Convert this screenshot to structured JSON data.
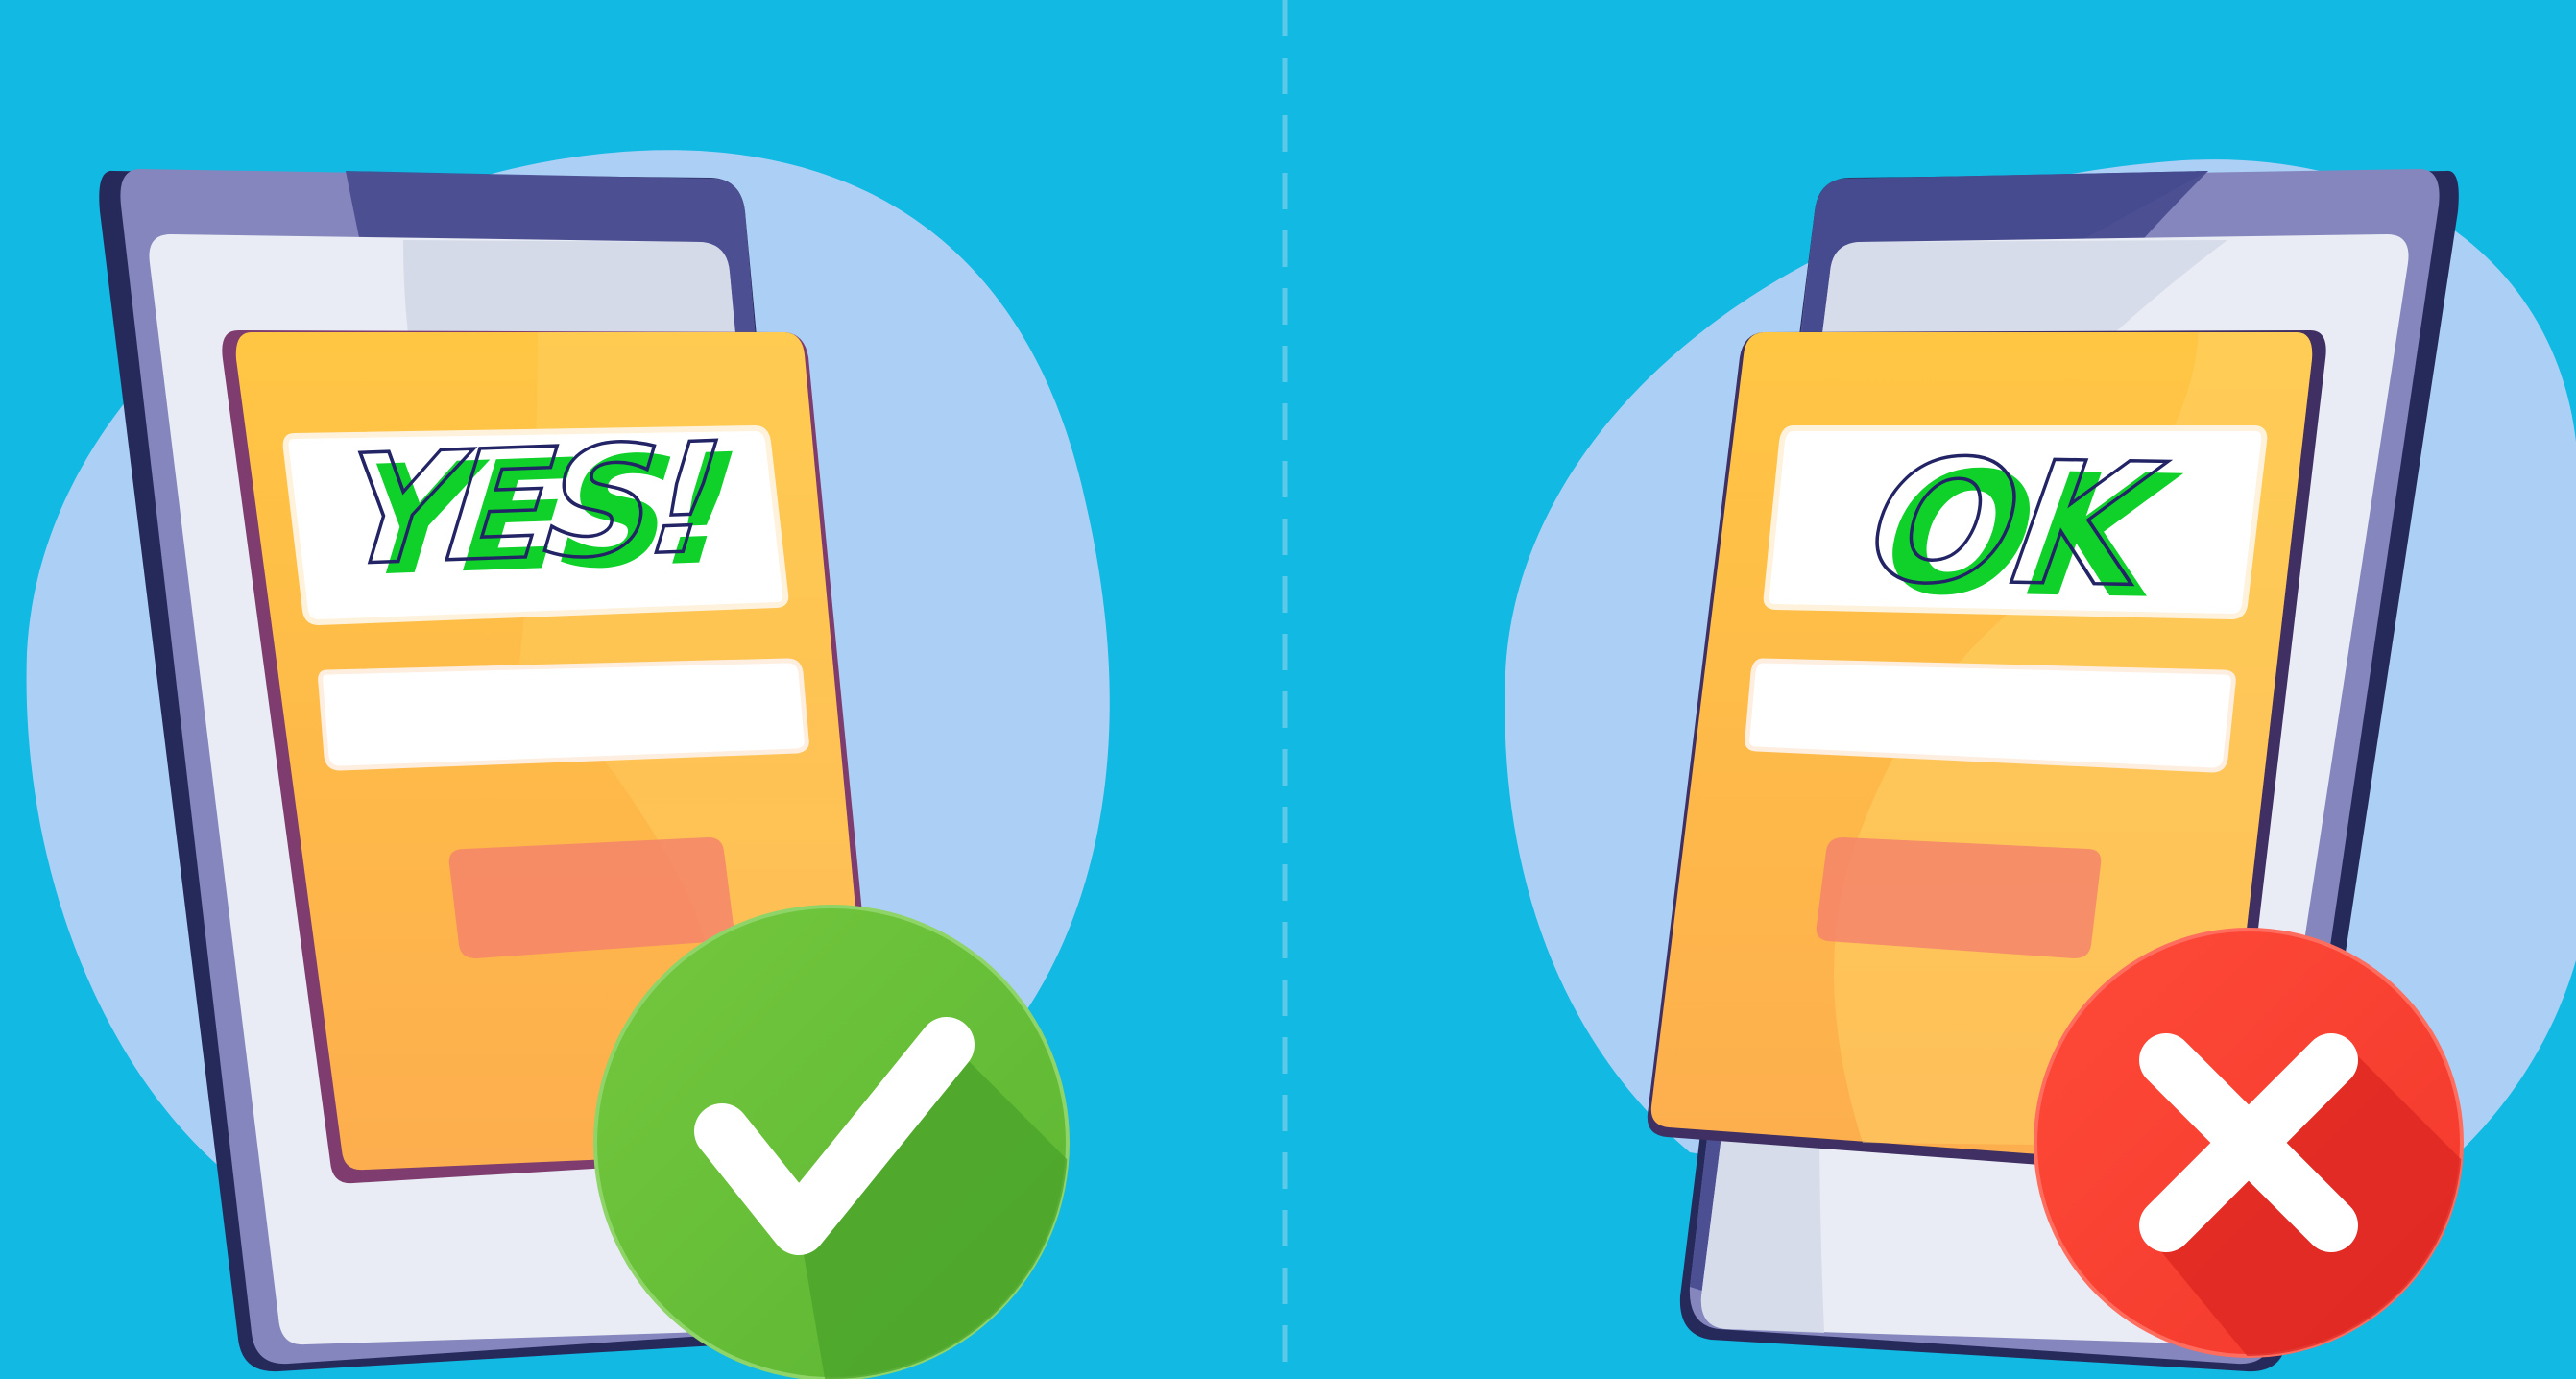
{
  "colors": {
    "background": "#11b9e3",
    "blob": "#acd0f5",
    "phone_frame": "#7f80bb",
    "phone_dark": "#262a5b",
    "screen": "#e9ecf4",
    "card_top": "#ffc443",
    "card_bottom": "#fdb04b",
    "stamp_green": "#10d02a",
    "stamp_outline": "#232465",
    "button": "#f4816d",
    "check_green": "#6cc43a",
    "cross_red": "#ff3f32"
  },
  "left_panel": {
    "stamp_text": "YES!",
    "badge_icon": "check-icon"
  },
  "right_panel": {
    "stamp_text": "OK",
    "badge_icon": "cross-icon"
  }
}
